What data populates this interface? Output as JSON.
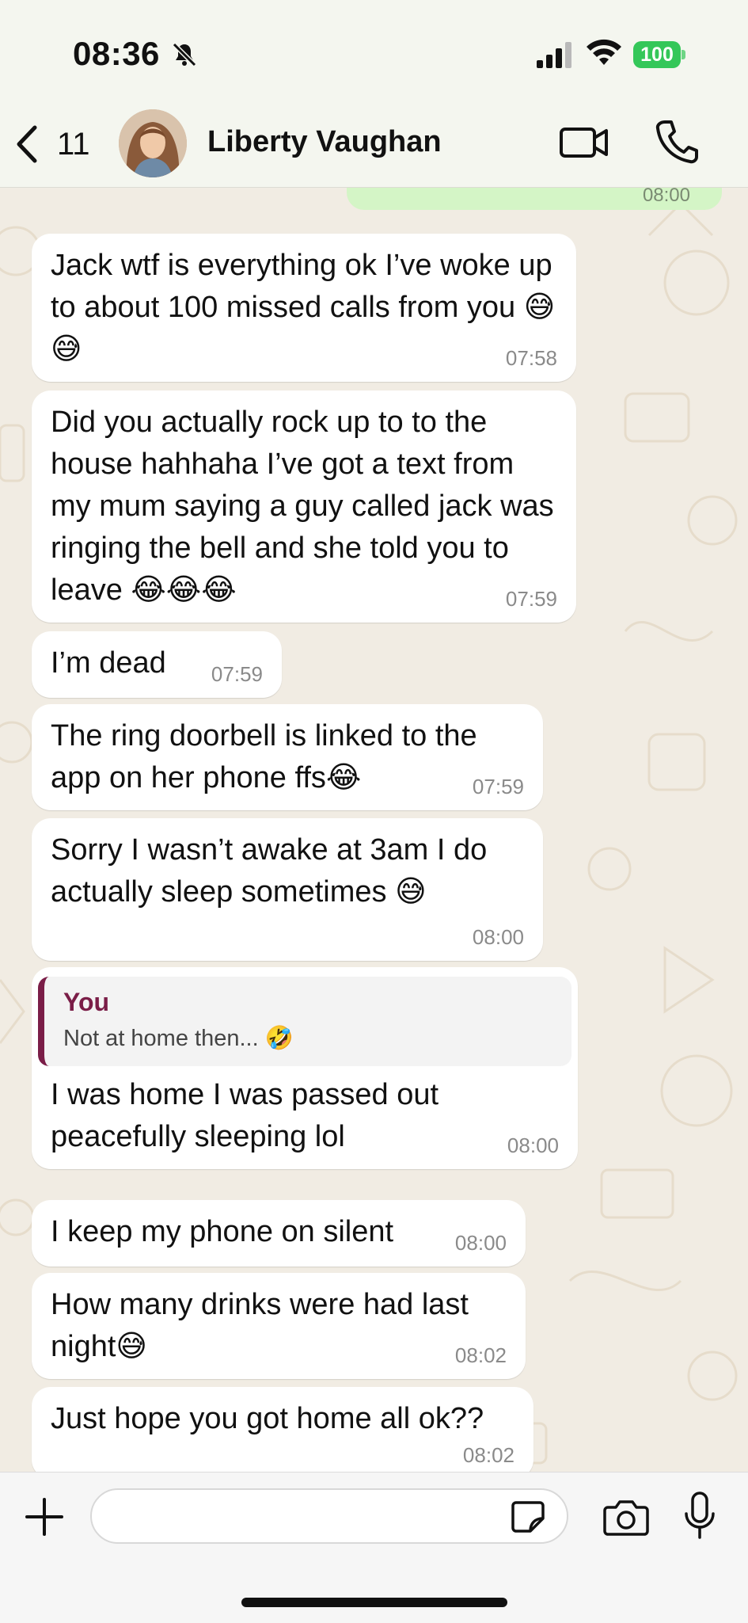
{
  "status_bar": {
    "time": "08:36",
    "battery": "100"
  },
  "header": {
    "back_count": "11",
    "contact_name": "Liberty Vaughan"
  },
  "messages": [
    {
      "text": "Jack wtf is everything ok I’ve woke up to about 100 missed calls from you 😅😅",
      "time": "07:58"
    },
    {
      "text": "Did you actually rock up to to the house hahhaha I’ve got a text from my mum saying a guy called jack was ringing the bell and she told you to leave 😂😂😂",
      "time": "07:59"
    },
    {
      "text": "I’m dead",
      "time": "07:59"
    },
    {
      "text": "The ring doorbell is linked to the app on her phone ffs😂",
      "time": "07:59"
    },
    {
      "text": "Sorry I wasn’t awake at 3am I do actually sleep sometimes 😅",
      "time": "08:00"
    },
    {
      "quote_author": "You",
      "quote_text": "Not at home then... 🤣",
      "text": "I was home I was passed out peacefully sleeping lol",
      "time": "08:00"
    },
    {
      "text": "I keep my phone on silent",
      "time": "08:00"
    },
    {
      "text": "How many drinks were had last night😅",
      "time": "08:02"
    },
    {
      "text": "Just hope you got home all ok??",
      "time": "08:02"
    }
  ],
  "input": {
    "placeholder": ""
  },
  "colors": {
    "outgoing_bubble": "#d4f5c6",
    "incoming_bubble": "#ffffff",
    "quote_accent": "#7a1d47",
    "battery": "#34c759",
    "chat_background": "#f1ece3"
  },
  "icons": [
    "bell-slash-icon",
    "signal-icon",
    "wifi-icon",
    "battery-icon",
    "chevron-left-icon",
    "video-camera-icon",
    "phone-icon",
    "plus-icon",
    "sticker-icon",
    "camera-icon",
    "microphone-icon"
  ]
}
